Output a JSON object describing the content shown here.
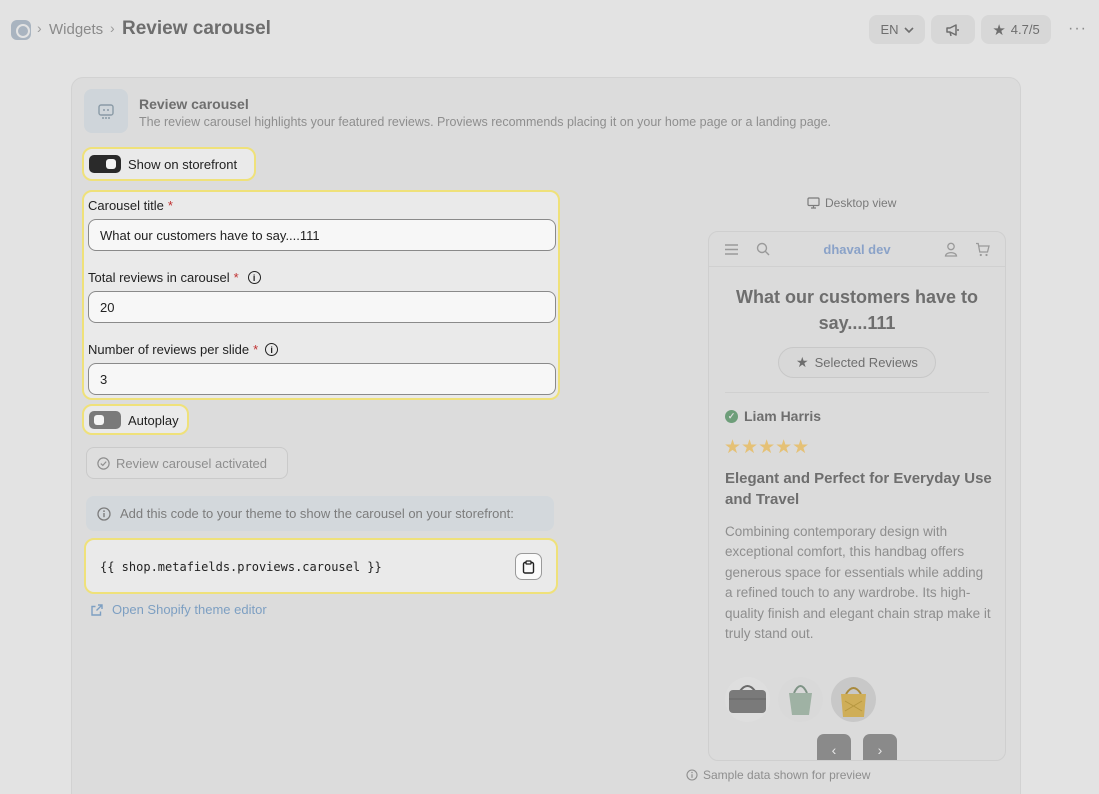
{
  "breadcrumb": {
    "parent": "Widgets",
    "current": "Review carousel"
  },
  "topbar": {
    "language": "EN",
    "rating": "4.7/5",
    "more": "···"
  },
  "card": {
    "title": "Review carousel",
    "description": "The review carousel highlights your featured reviews. Proviews recommends placing it on your home page or a landing page."
  },
  "show_on_storefront": {
    "label": "Show on storefront",
    "on": true
  },
  "carousel_title": {
    "label": "Carousel title",
    "required": "*",
    "value": "What our customers have to say....111"
  },
  "total_reviews": {
    "label": "Total reviews in carousel",
    "required": "*",
    "value": "20"
  },
  "reviews_per_slide": {
    "label": "Number of reviews per slide",
    "required": "*",
    "value": "3"
  },
  "autoplay": {
    "label": "Autoplay",
    "on": false
  },
  "activated": {
    "label": "Review carousel activated"
  },
  "notice": {
    "text": "Add this code to your theme to show the carousel on your storefront:"
  },
  "code": {
    "snippet": "{{ shop.metafields.proviews.carousel }}"
  },
  "theme_link": {
    "label": "Open Shopify theme editor"
  },
  "preview": {
    "view_label": "Desktop view",
    "store_name": "dhaval dev",
    "title": "What our customers have to say....111",
    "badge": "Selected Reviews",
    "reviewer": "Liam Harris",
    "stars": "★★★★★",
    "rating": 5,
    "review_title": "Elegant and Perfect for Everyday Use and Travel",
    "review_body": "Combining contemporary design with exceptional comfort, this handbag offers generous space for essentials while adding a refined touch to any wardrobe. Its high-quality finish and elegant chain strap make it truly stand out.",
    "prev": "‹",
    "next": "›",
    "sample_note": "Sample data shown for preview"
  },
  "colors": {
    "highlight": "#efe17a",
    "accent_link": "#7d9fc2",
    "star": "#e5c176"
  }
}
